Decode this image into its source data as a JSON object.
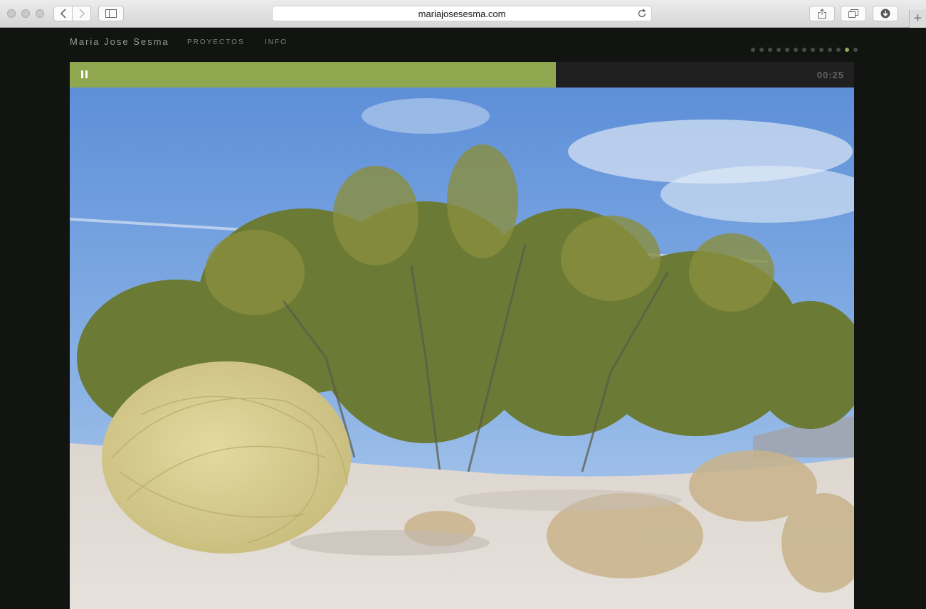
{
  "browser": {
    "url": "mariajosesesma.com",
    "icons": [
      "back-icon",
      "forward-icon",
      "sidebar-icon",
      "reload-icon",
      "share-icon",
      "tabs-icon",
      "download-icon",
      "new-tab-icon"
    ]
  },
  "site": {
    "name": "Maria Jose Sesma",
    "nav": [
      "PROYECTOS",
      "INFO"
    ]
  },
  "slideshow": {
    "slide_count": 13,
    "active_slide": 12,
    "progress_fraction": 0.62,
    "timer": "00:25",
    "accent_color": "#8fa84f"
  },
  "photo": {
    "description_icon": "desert-shrub-photo"
  }
}
